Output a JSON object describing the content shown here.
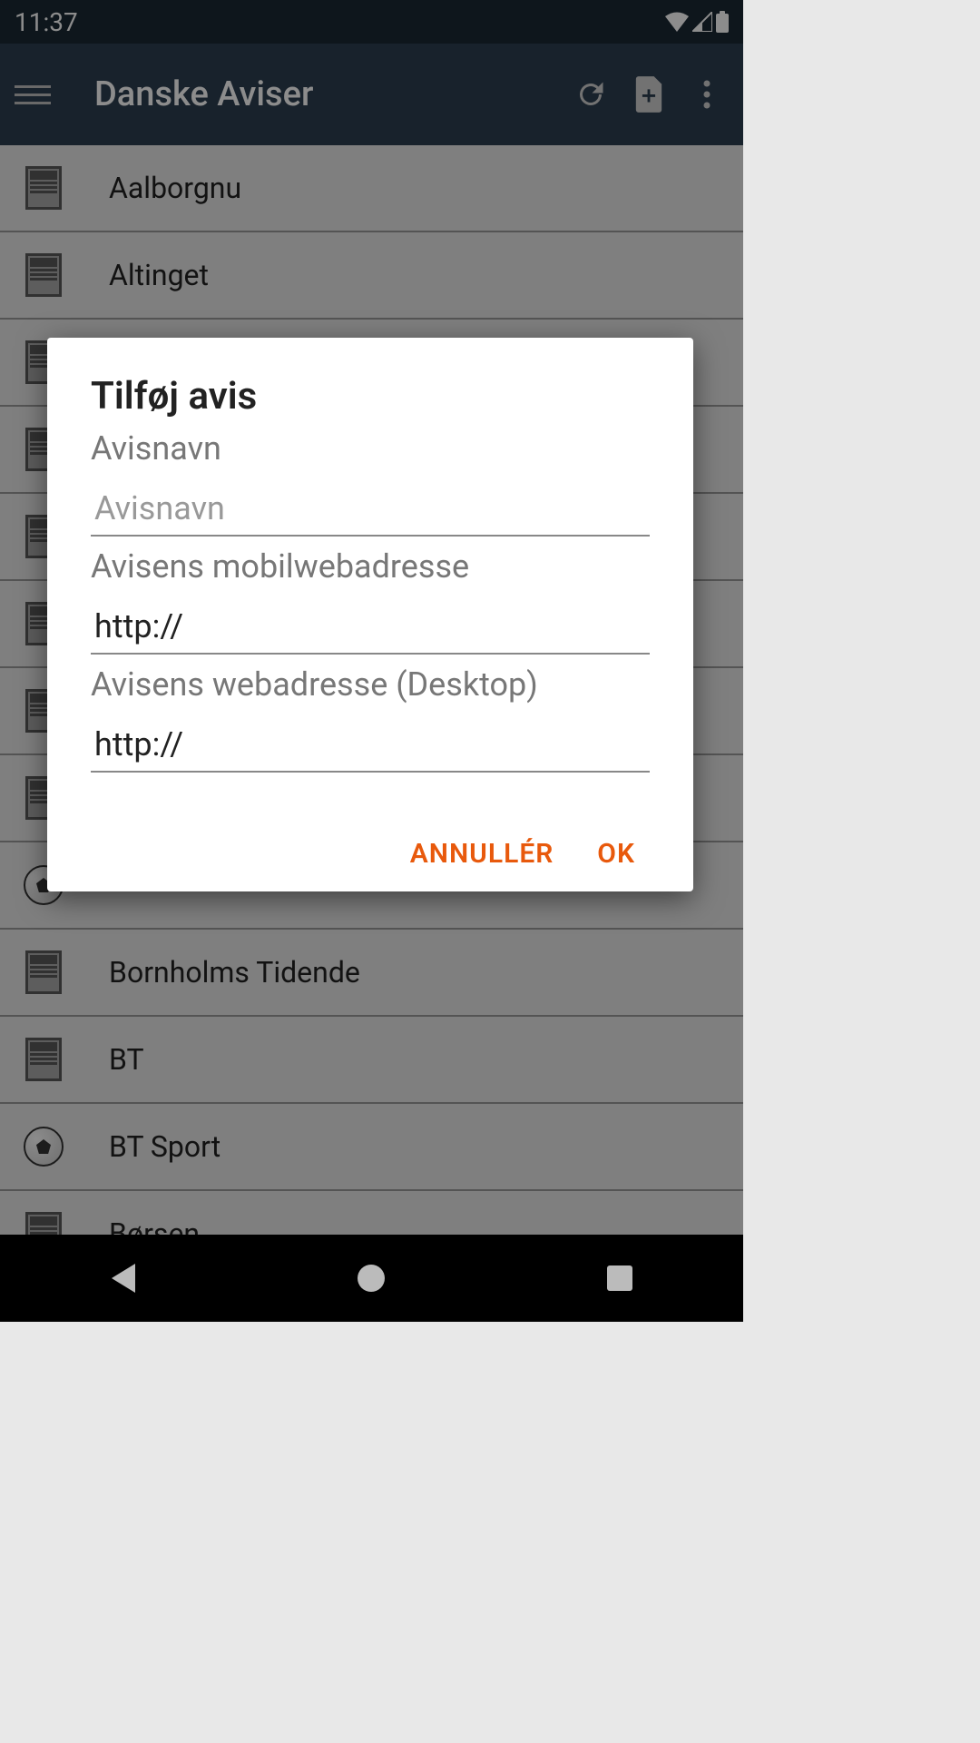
{
  "status": {
    "time": "11:37"
  },
  "header": {
    "title": "Danske Aviser"
  },
  "list": {
    "items": [
      {
        "label": "Aalborgnu",
        "icon": "newspaper"
      },
      {
        "label": "Altinget",
        "icon": "newspaper"
      },
      {
        "label": "",
        "icon": "newspaper"
      },
      {
        "label": "",
        "icon": "newspaper"
      },
      {
        "label": "",
        "icon": "newspaper"
      },
      {
        "label": "",
        "icon": "newspaper"
      },
      {
        "label": "",
        "icon": "newspaper"
      },
      {
        "label": "",
        "icon": "newspaper"
      },
      {
        "label": "",
        "icon": "soccer"
      },
      {
        "label": "Bornholms Tidende",
        "icon": "newspaper"
      },
      {
        "label": "BT",
        "icon": "newspaper"
      },
      {
        "label": "BT Sport",
        "icon": "soccer"
      },
      {
        "label": "Børsen",
        "icon": "newspaper"
      }
    ]
  },
  "dialog": {
    "title": "Tilføj avis",
    "name_label": "Avisnavn",
    "name_placeholder": "Avisnavn",
    "name_value": "",
    "mobile_label": "Avisens mobilwebadresse",
    "mobile_value": "http://",
    "desktop_label": "Avisens webadresse (Desktop)",
    "desktop_value": "http://",
    "cancel_label": "ANNULLÉR",
    "ok_label": "OK"
  }
}
